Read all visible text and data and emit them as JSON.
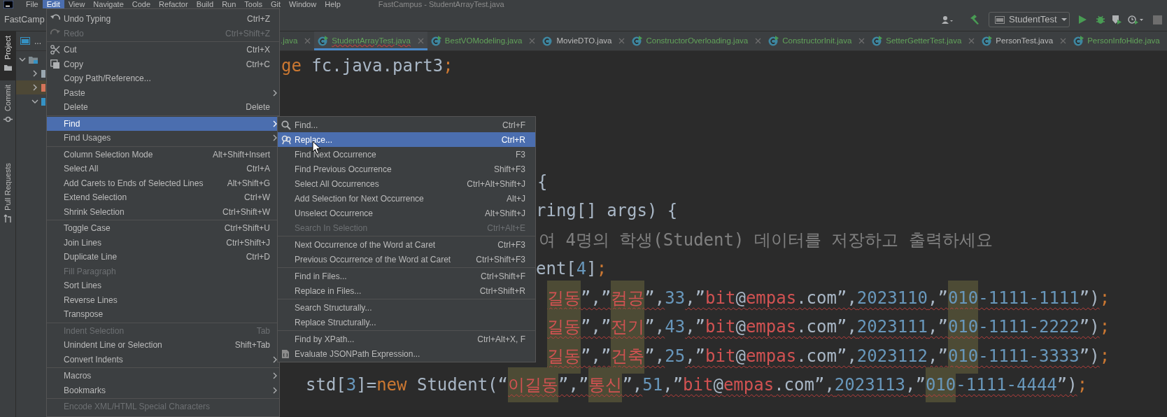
{
  "menu_bar": {
    "items": [
      {
        "label": "File",
        "selected": false
      },
      {
        "label": "Edit",
        "selected": true
      },
      {
        "label": "View",
        "selected": false
      },
      {
        "label": "Navigate",
        "selected": false
      },
      {
        "label": "Code",
        "selected": false
      },
      {
        "label": "Refactor",
        "selected": false
      },
      {
        "label": "Build",
        "selected": false
      },
      {
        "label": "Run",
        "selected": false
      },
      {
        "label": "Tools",
        "selected": false
      },
      {
        "label": "Git",
        "selected": false
      },
      {
        "label": "Window",
        "selected": false
      },
      {
        "label": "Help",
        "selected": false
      }
    ],
    "title": "FastCampus - StudentArrayTest.java"
  },
  "toolbar": {
    "project": "FastCamp",
    "run_config": "StudentTest"
  },
  "tool_stripe": [
    {
      "label": "Project",
      "selected": true
    },
    {
      "label": "Commit",
      "selected": false
    },
    {
      "label": "Pull Requests",
      "selected": false
    }
  ],
  "project_panel": {
    "header": "...",
    "tree": [
      {
        "kind": "module",
        "expanded": true,
        "selected": false,
        "children": [
          {
            "kind": "folder",
            "expanded": false,
            "selected": false
          },
          {
            "kind": "excluded",
            "expanded": false,
            "selected": true
          },
          {
            "kind": "source",
            "expanded": true,
            "selected": false
          }
        ]
      }
    ]
  },
  "tabs": [
    {
      "label": ".java",
      "kind": "none",
      "selected": false,
      "color": "#62a35a",
      "has_errors": false
    },
    {
      "label": "StudentArrayTest.java",
      "kind": "runnable",
      "selected": true,
      "color": "#62a35a",
      "has_errors": true
    },
    {
      "label": "BestVOModeling.java",
      "kind": "runnable",
      "selected": false,
      "color": "#62a35a",
      "has_errors": false
    },
    {
      "label": "MovieDTO.java",
      "kind": "class",
      "selected": false,
      "color": "#bbbbbb",
      "has_errors": false
    },
    {
      "label": "ConstructorOverloading.java",
      "kind": "runnable",
      "selected": false,
      "color": "#62a35a",
      "has_errors": false
    },
    {
      "label": "ConstructorInit.java",
      "kind": "runnable",
      "selected": false,
      "color": "#62a35a",
      "has_errors": false
    },
    {
      "label": "SetterGetterTest.java",
      "kind": "runnable",
      "selected": false,
      "color": "#62a35a",
      "has_errors": false
    },
    {
      "label": "PersonTest.java",
      "kind": "runnable",
      "selected": false,
      "color": "#bbbbbb",
      "has_errors": false
    },
    {
      "label": "PersonInfoHide.java",
      "kind": "runnable",
      "selected": false,
      "color": "#62a35a",
      "has_errors": false
    }
  ],
  "editor": {
    "lines": [
      {
        "tokens": [
          {
            "t": "ge",
            "kind": "keyword"
          },
          {
            "t": " fc.java.part3",
            "kind": "plain"
          },
          {
            "t": ";",
            "kind": "keyword"
          }
        ]
      },
      {
        "tokens": [
          {
            "t": "{",
            "kind": "plain"
          }
        ]
      },
      {
        "tokens": [
          {
            "t": "ring[] args) {",
            "kind": "plain"
          }
        ]
      },
      {
        "tokens": [
          {
            "t": "여 4명의 학생(Student) 데이터를 저장하고 출력하세요",
            "kind": "comment"
          }
        ]
      },
      {
        "tokens": [
          {
            "t": "ent[",
            "kind": "plain"
          },
          {
            "t": "4",
            "kind": "number"
          },
          {
            "t": "]",
            "kind": "plain"
          },
          {
            "t": ";",
            "kind": "keyword"
          }
        ]
      },
      {
        "tokens": [
          {
            "t": "길동",
            "kind": "string",
            "hl": true,
            "err": true
          },
          {
            "t": "”,”",
            "kind": "plain",
            "err": true
          },
          {
            "t": "컴공",
            "kind": "string",
            "hl": true,
            "err": true
          },
          {
            "t": "”,",
            "kind": "plain",
            "err": true
          },
          {
            "t": "33",
            "kind": "number"
          },
          {
            "t": ",”",
            "kind": "plain",
            "err": true
          },
          {
            "t": "bit",
            "kind": "string",
            "err": true
          },
          {
            "t": "@",
            "kind": "plain",
            "err": true
          },
          {
            "t": "empas",
            "kind": "string",
            "err": true
          },
          {
            "t": ".com”,",
            "kind": "plain",
            "err": true
          },
          {
            "t": "2023110",
            "kind": "number",
            "err": true
          },
          {
            "t": ",”",
            "kind": "plain",
            "err": true
          },
          {
            "t": "010",
            "kind": "number",
            "hl": true,
            "err": true
          },
          {
            "t": "-1111-1111",
            "kind": "number",
            "err": true
          },
          {
            "t": "”)",
            "kind": "plain",
            "err": true
          },
          {
            "t": ";",
            "kind": "keyword"
          }
        ]
      },
      {
        "tokens": [
          {
            "t": "길동",
            "kind": "string",
            "hl": true,
            "err": true
          },
          {
            "t": "”,”",
            "kind": "plain",
            "err": true
          },
          {
            "t": "전기",
            "kind": "string",
            "hl": true,
            "err": true
          },
          {
            "t": "”,",
            "kind": "plain",
            "err": true
          },
          {
            "t": "43",
            "kind": "number"
          },
          {
            "t": ",”",
            "kind": "plain",
            "err": true
          },
          {
            "t": "bit",
            "kind": "string",
            "err": true
          },
          {
            "t": "@",
            "kind": "plain",
            "err": true
          },
          {
            "t": "empas",
            "kind": "string",
            "err": true
          },
          {
            "t": ".com”,",
            "kind": "plain",
            "err": true
          },
          {
            "t": "2023111",
            "kind": "number",
            "err": true
          },
          {
            "t": ",”",
            "kind": "plain",
            "err": true
          },
          {
            "t": "010",
            "kind": "number",
            "hl": true,
            "err": true
          },
          {
            "t": "-1111-2222",
            "kind": "number",
            "err": true
          },
          {
            "t": "”)",
            "kind": "plain",
            "err": true
          },
          {
            "t": ";",
            "kind": "keyword"
          }
        ]
      },
      {
        "tokens": [
          {
            "t": "길동",
            "kind": "string",
            "hl": true,
            "err": true
          },
          {
            "t": "”,”",
            "kind": "plain",
            "err": true
          },
          {
            "t": "건축",
            "kind": "string",
            "hl": true,
            "err": true
          },
          {
            "t": "”,",
            "kind": "plain",
            "err": true
          },
          {
            "t": "25",
            "kind": "number"
          },
          {
            "t": ",”",
            "kind": "plain",
            "err": true
          },
          {
            "t": "bit",
            "kind": "string",
            "err": true
          },
          {
            "t": "@",
            "kind": "plain",
            "err": true
          },
          {
            "t": "empas",
            "kind": "string",
            "err": true
          },
          {
            "t": ".com”,",
            "kind": "plain",
            "err": true
          },
          {
            "t": "2023112",
            "kind": "number",
            "err": true
          },
          {
            "t": ",”",
            "kind": "plain",
            "err": true
          },
          {
            "t": "010",
            "kind": "number",
            "hl": true,
            "err": true
          },
          {
            "t": "-1111-3333",
            "kind": "number",
            "err": true
          },
          {
            "t": "”)",
            "kind": "plain",
            "err": true
          },
          {
            "t": ";",
            "kind": "keyword"
          }
        ]
      },
      {
        "tokens": [
          {
            "t": "std[",
            "kind": "plain"
          },
          {
            "t": "3",
            "kind": "number"
          },
          {
            "t": "]=",
            "kind": "plain"
          },
          {
            "t": "new",
            "kind": "keyword"
          },
          {
            "t": " Student(“",
            "kind": "plain"
          },
          {
            "t": "이길동",
            "kind": "string",
            "hl": true,
            "err": true
          },
          {
            "t": "”,”",
            "kind": "plain",
            "err": true
          },
          {
            "t": "통신",
            "kind": "string",
            "hl": true,
            "err": true
          },
          {
            "t": "”,",
            "kind": "plain",
            "err": true
          },
          {
            "t": "51",
            "kind": "number"
          },
          {
            "t": ",”",
            "kind": "plain",
            "err": true
          },
          {
            "t": "bit",
            "kind": "string",
            "err": true
          },
          {
            "t": "@",
            "kind": "plain",
            "err": true
          },
          {
            "t": "empas",
            "kind": "string",
            "err": true
          },
          {
            "t": ".com”,",
            "kind": "plain",
            "err": true
          },
          {
            "t": "2023113",
            "kind": "number",
            "err": true
          },
          {
            "t": ",”",
            "kind": "plain",
            "err": true
          },
          {
            "t": "010",
            "kind": "number",
            "hl": true,
            "err": true
          },
          {
            "t": "-1111-4444",
            "kind": "number",
            "err": true
          },
          {
            "t": "”)",
            "kind": "plain",
            "err": true
          },
          {
            "t": ";",
            "kind": "keyword"
          }
        ]
      }
    ]
  },
  "edit_menu": {
    "items": [
      {
        "kind": "item",
        "label": "Undo Typing",
        "shortcut": "Ctrl+Z",
        "disabled": false,
        "selected": false,
        "submenu": false
      },
      {
        "kind": "item",
        "label": "Redo",
        "shortcut": "Ctrl+Shift+Z",
        "disabled": true,
        "selected": false,
        "submenu": false
      },
      {
        "kind": "separator"
      },
      {
        "kind": "item",
        "label": "Cut",
        "shortcut": "Ctrl+X",
        "disabled": false,
        "selected": false,
        "submenu": false
      },
      {
        "kind": "item",
        "label": "Copy",
        "shortcut": "Ctrl+C",
        "disabled": false,
        "selected": false,
        "submenu": false
      },
      {
        "kind": "item",
        "label": "Copy Path/Reference...",
        "disabled": false,
        "selected": false,
        "submenu": false
      },
      {
        "kind": "item",
        "label": "Paste",
        "disabled": false,
        "selected": false,
        "submenu": true
      },
      {
        "kind": "item",
        "label": "Delete",
        "shortcut": "Delete",
        "disabled": false,
        "selected": false,
        "submenu": false
      },
      {
        "kind": "separator"
      },
      {
        "kind": "item",
        "label": "Find",
        "disabled": false,
        "selected": true,
        "submenu": true
      },
      {
        "kind": "item",
        "label": "Find Usages",
        "disabled": false,
        "selected": false,
        "submenu": true
      },
      {
        "kind": "separator"
      },
      {
        "kind": "item",
        "label": "Column Selection Mode",
        "shortcut": "Alt+Shift+Insert",
        "disabled": false,
        "selected": false,
        "submenu": false
      },
      {
        "kind": "item",
        "label": "Select All",
        "shortcut": "Ctrl+A",
        "disabled": false,
        "selected": false,
        "submenu": false
      },
      {
        "kind": "item",
        "label": "Add Carets to Ends of Selected Lines",
        "shortcut": "Alt+Shift+G",
        "disabled": false,
        "selected": false,
        "submenu": false
      },
      {
        "kind": "item",
        "label": "Extend Selection",
        "shortcut": "Ctrl+W",
        "disabled": false,
        "selected": false,
        "submenu": false
      },
      {
        "kind": "item",
        "label": "Shrink Selection",
        "shortcut": "Ctrl+Shift+W",
        "disabled": false,
        "selected": false,
        "submenu": false
      },
      {
        "kind": "separator"
      },
      {
        "kind": "item",
        "label": "Toggle Case",
        "shortcut": "Ctrl+Shift+U",
        "disabled": false,
        "selected": false,
        "submenu": false
      },
      {
        "kind": "item",
        "label": "Join Lines",
        "shortcut": "Ctrl+Shift+J",
        "disabled": false,
        "selected": false,
        "submenu": false
      },
      {
        "kind": "item",
        "label": "Duplicate Line",
        "shortcut": "Ctrl+D",
        "disabled": false,
        "selected": false,
        "submenu": false
      },
      {
        "kind": "item",
        "label": "Fill Paragraph",
        "disabled": true,
        "selected": false,
        "submenu": false
      },
      {
        "kind": "item",
        "label": "Sort Lines",
        "disabled": false,
        "selected": false,
        "submenu": false
      },
      {
        "kind": "item",
        "label": "Reverse Lines",
        "disabled": false,
        "selected": false,
        "submenu": false
      },
      {
        "kind": "item",
        "label": "Transpose",
        "disabled": false,
        "selected": false,
        "submenu": false
      },
      {
        "kind": "separator"
      },
      {
        "kind": "item",
        "label": "Indent Selection",
        "shortcut": "Tab",
        "disabled": true,
        "selected": false,
        "submenu": false
      },
      {
        "kind": "item",
        "label": "Unindent Line or Selection",
        "shortcut": "Shift+Tab",
        "disabled": false,
        "selected": false,
        "submenu": false
      },
      {
        "kind": "item",
        "label": "Convert Indents",
        "disabled": false,
        "selected": false,
        "submenu": true
      },
      {
        "kind": "separator"
      },
      {
        "kind": "item",
        "label": "Macros",
        "disabled": false,
        "selected": false,
        "submenu": true
      },
      {
        "kind": "item",
        "label": "Bookmarks",
        "disabled": false,
        "selected": false,
        "submenu": true
      },
      {
        "kind": "separator"
      },
      {
        "kind": "item",
        "label": "Encode XML/HTML Special Characters",
        "disabled": true,
        "selected": false,
        "submenu": false
      }
    ]
  },
  "find_submenu": {
    "items": [
      {
        "kind": "item",
        "label": "Find...",
        "shortcut": "Ctrl+F",
        "disabled": false,
        "selected": false
      },
      {
        "kind": "item",
        "label": "Replace...",
        "shortcut": "Ctrl+R",
        "disabled": false,
        "selected": true
      },
      {
        "kind": "item",
        "label": "Find Next Occurrence",
        "shortcut": "F3",
        "disabled": false,
        "selected": false
      },
      {
        "kind": "item",
        "label": "Find Previous Occurrence",
        "shortcut": "Shift+F3",
        "disabled": false,
        "selected": false
      },
      {
        "kind": "item",
        "label": "Select All Occurrences",
        "shortcut": "Ctrl+Alt+Shift+J",
        "disabled": false,
        "selected": false
      },
      {
        "kind": "item",
        "label": "Add Selection for Next Occurrence",
        "shortcut": "Alt+J",
        "disabled": false,
        "selected": false
      },
      {
        "kind": "item",
        "label": "Unselect Occurrence",
        "shortcut": "Alt+Shift+J",
        "disabled": false,
        "selected": false
      },
      {
        "kind": "item",
        "label": "Search In Selection",
        "shortcut": "Ctrl+Alt+E",
        "disabled": true,
        "selected": false
      },
      {
        "kind": "separator"
      },
      {
        "kind": "item",
        "label": "Next Occurrence of the Word at Caret",
        "shortcut": "Ctrl+F3",
        "disabled": false,
        "selected": false
      },
      {
        "kind": "item",
        "label": "Previous Occurrence of the Word at Caret",
        "shortcut": "Ctrl+Shift+F3",
        "disabled": false,
        "selected": false
      },
      {
        "kind": "separator"
      },
      {
        "kind": "item",
        "label": "Find in Files...",
        "shortcut": "Ctrl+Shift+F",
        "disabled": false,
        "selected": false
      },
      {
        "kind": "item",
        "label": "Replace in Files...",
        "shortcut": "Ctrl+Shift+R",
        "disabled": false,
        "selected": false
      },
      {
        "kind": "separator"
      },
      {
        "kind": "item",
        "label": "Search Structurally...",
        "disabled": false,
        "selected": false
      },
      {
        "kind": "item",
        "label": "Replace Structurally...",
        "disabled": false,
        "selected": false
      },
      {
        "kind": "separator"
      },
      {
        "kind": "item",
        "label": "Find by XPath...",
        "shortcut": "Ctrl+Alt+X, F",
        "disabled": false,
        "selected": false
      },
      {
        "kind": "item",
        "label": "Evaluate JSONPath Expression...",
        "disabled": false,
        "selected": false
      }
    ]
  }
}
